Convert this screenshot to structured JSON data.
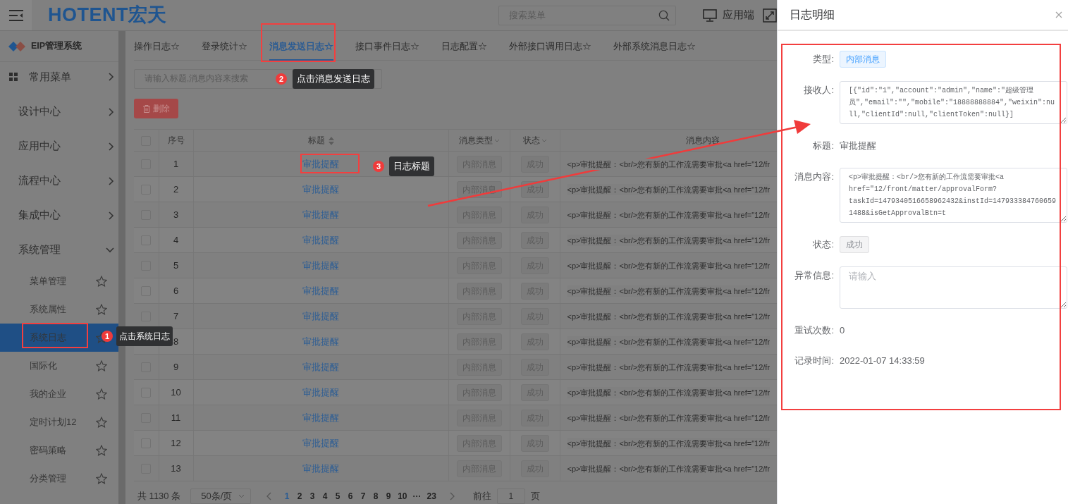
{
  "header": {
    "logo": "HOTENT宏天",
    "search": {
      "placeholder": "搜索菜单"
    },
    "app_switch": "应用端"
  },
  "sidebar": {
    "title": "EIP管理系统",
    "items": [
      {
        "label": "常用菜单",
        "kind": "favorites",
        "expanded": false
      },
      {
        "label": "设计中心",
        "kind": "menu",
        "expanded": false
      },
      {
        "label": "应用中心",
        "kind": "menu",
        "expanded": false
      },
      {
        "label": "流程中心",
        "kind": "menu",
        "expanded": false
      },
      {
        "label": "集成中心",
        "kind": "menu",
        "expanded": false
      },
      {
        "label": "系统管理",
        "kind": "menu",
        "expanded": true,
        "children": [
          {
            "label": "菜单管理",
            "selected": false
          },
          {
            "label": "系统属性",
            "selected": false
          },
          {
            "label": "系统日志",
            "selected": true
          },
          {
            "label": "国际化",
            "selected": false
          },
          {
            "label": "我的企业",
            "selected": false
          },
          {
            "label": "定时计划12",
            "selected": false
          },
          {
            "label": "密码策略",
            "selected": false
          },
          {
            "label": "分类管理",
            "selected": false
          }
        ]
      }
    ]
  },
  "tabs": [
    {
      "label": "操作日志☆",
      "selected": false
    },
    {
      "label": "登录统计☆",
      "selected": false
    },
    {
      "label": "消息发送日志☆",
      "selected": true
    },
    {
      "label": "接口事件日志☆",
      "selected": false
    },
    {
      "label": "日志配置☆",
      "selected": false
    },
    {
      "label": "外部接口调用日志☆",
      "selected": false
    },
    {
      "label": "外部系统消息日志☆",
      "selected": false
    }
  ],
  "search": {
    "placeholder": "请输入标题,消息内容来搜索"
  },
  "delete_button": "删除",
  "table": {
    "all_checked": false,
    "columns": [
      {
        "label": "序号",
        "kind": "plain"
      },
      {
        "label": "标题",
        "kind": "sortable"
      },
      {
        "label": "消息类型",
        "kind": "filter"
      },
      {
        "label": "状态",
        "kind": "filter"
      },
      {
        "label": "消息内容",
        "kind": "plain"
      }
    ],
    "rows": [
      {
        "checked": false,
        "number": "1",
        "title": "审批提醒",
        "type": "内部消息",
        "status": "成功",
        "content": "<p>审批提醒：<br/>您有新的工作流需要审批<a href=\"12/fr"
      },
      {
        "checked": false,
        "number": "2",
        "title": "审批提醒",
        "type": "内部消息",
        "status": "成功",
        "content": "<p>审批提醒：<br/>您有新的工作流需要审批<a href=\"12/fr"
      },
      {
        "checked": false,
        "number": "3",
        "title": "审批提醒",
        "type": "内部消息",
        "status": "成功",
        "content": "<p>审批提醒：<br/>您有新的工作流需要审批<a href=\"12/fr"
      },
      {
        "checked": false,
        "number": "4",
        "title": "审批提醒",
        "type": "内部消息",
        "status": "成功",
        "content": "<p>审批提醒：<br/>您有新的工作流需要审批<a href=\"12/fr"
      },
      {
        "checked": false,
        "number": "5",
        "title": "审批提醒",
        "type": "内部消息",
        "status": "成功",
        "content": "<p>审批提醒：<br/>您有新的工作流需要审批<a href=\"12/fr"
      },
      {
        "checked": false,
        "number": "6",
        "title": "审批提醒",
        "type": "内部消息",
        "status": "成功",
        "content": "<p>审批提醒：<br/>您有新的工作流需要审批<a href=\"12/fr"
      },
      {
        "checked": false,
        "number": "7",
        "title": "审批提醒",
        "type": "内部消息",
        "status": "成功",
        "content": "<p>审批提醒：<br/>您有新的工作流需要审批<a href=\"12/fr"
      },
      {
        "number": "8",
        "title": "审批提醒",
        "type": "内部消息",
        "status": "成功",
        "content": "<p>审批提醒：<br/>您有新的工作流需要审批<a href=\"12/fr"
      },
      {
        "checked": false,
        "number": "9",
        "title": "审批提醒",
        "type": "内部消息",
        "status": "成功",
        "content": "<p>审批提醒：<br/>您有新的工作流需要审批<a href=\"12/fr"
      },
      {
        "checked": false,
        "number": "10",
        "title": "审批提醒",
        "type": "内部消息",
        "status": "成功",
        "content": "<p>审批提醒：<br/>您有新的工作流需要审批<a href=\"12/fr"
      },
      {
        "checked": false,
        "number": "11",
        "title": "审批提醒",
        "type": "内部消息",
        "status": "成功",
        "content": "<p>审批提醒：<br/>您有新的工作流需要审批<a href=\"12/fr"
      },
      {
        "checked": false,
        "number": "12",
        "title": "审批提醒",
        "type": "内部消息",
        "status": "成功",
        "content": "<p>审批提醒：<br/>您有新的工作流需要审批<a href=\"12/fr"
      },
      {
        "checked": false,
        "number": "13",
        "title": "审批提醒",
        "type": "内部消息",
        "status": "成功",
        "content": "<p>审批提醒：<br/>您有新的工作流需要审批<a href=\"12/fr"
      }
    ]
  },
  "pagination": {
    "total": "共 1130 条",
    "page_size": "50条/页",
    "pages": [
      {
        "label": "1",
        "selected": true
      },
      {
        "label": "2",
        "selected": false
      },
      {
        "label": "3",
        "selected": false
      },
      {
        "label": "4",
        "selected": false
      },
      {
        "label": "5",
        "selected": false
      },
      {
        "label": "6",
        "selected": false
      },
      {
        "label": "7",
        "selected": false
      },
      {
        "label": "8",
        "selected": false
      },
      {
        "label": "9",
        "selected": false
      },
      {
        "label": "10",
        "selected": false
      }
    ],
    "ellipsis": "···",
    "last_page": "23",
    "goto_label": "前往",
    "goto_value": "1",
    "goto_suffix": "页"
  },
  "drawer": {
    "title": "日志明细",
    "fields": [
      {
        "label": "类型:",
        "kind": "tag",
        "value": "内部消息",
        "color": "#409eff"
      },
      {
        "label": "接收人:",
        "kind": "textarea",
        "value": "[{\"id\":\"1\",\"account\":\"admin\",\"name\":\"超级管理员\",\"email\":\"\",\"mobile\":\"18888888884\",\"weixin\":null,\"clientId\":null,\"clientToken\":null}]"
      },
      {
        "label": "标题:",
        "kind": "text",
        "value": "审批提醒"
      },
      {
        "label": "消息内容:",
        "kind": "textarea",
        "value": "<p>审批提醒：<br/>您有新的工作流需要审批<a href=\"12/front/matter/approvalForm?taskId=1479340516658962432&instId=1479333847606591488&isGetApprovalBtn=t"
      },
      {
        "label": "状态:",
        "kind": "tag",
        "value": "成功",
        "color": "#909399"
      },
      {
        "label": "异常信息:",
        "kind": "textarea",
        "placeholder": "请输入"
      },
      {
        "label": "重试次数:",
        "kind": "text",
        "value": "0"
      },
      {
        "label": "记录时间:",
        "kind": "text",
        "value": "2022-01-07 14:33:59"
      }
    ]
  },
  "annotations": [
    {
      "number": "1",
      "text": "点击系统日志"
    },
    {
      "number": "2",
      "text": "点击消息发送日志"
    },
    {
      "number": "3",
      "text": "日志标题"
    }
  ]
}
